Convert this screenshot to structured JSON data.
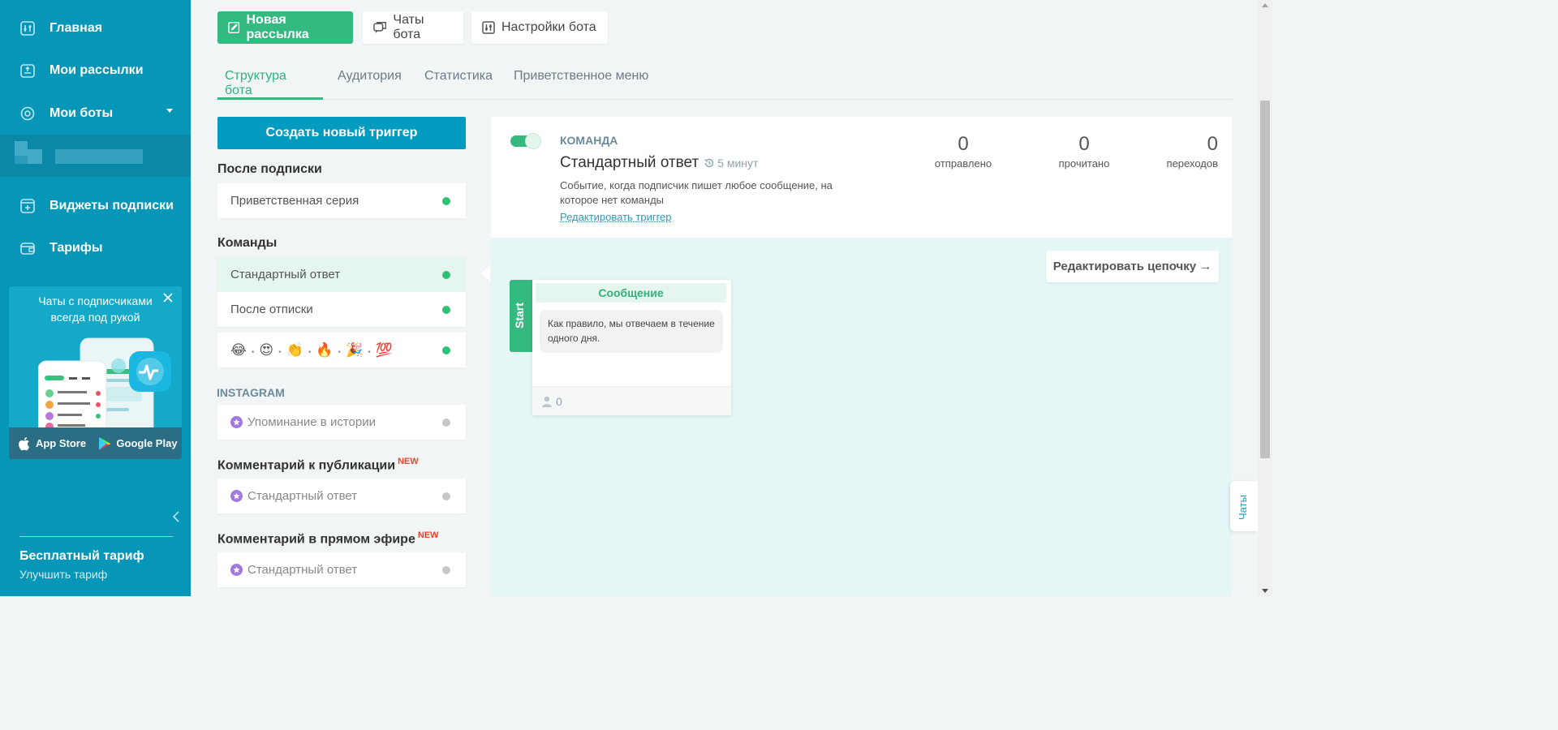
{
  "sidebar": {
    "nav": [
      {
        "label": "Главная",
        "icon": "home-icon"
      },
      {
        "label": "Мои рассылки",
        "icon": "mailing-icon"
      },
      {
        "label": "Мои боты",
        "icon": "bots-icon"
      },
      {
        "label": "Виджеты подписки",
        "icon": "widget-icon"
      },
      {
        "label": "Тарифы",
        "icon": "wallet-icon"
      }
    ],
    "promo": {
      "text": "Чаты с подписчиками всегда под рукой",
      "app_store": "App Store",
      "google_play": "Google Play"
    },
    "plan": {
      "title": "Бесплатный тариф",
      "link": "Улучшить тариф"
    }
  },
  "toolbar": {
    "new_mailing": "Новая рассылка",
    "bot_chats": "Чаты бота",
    "bot_settings": "Настройки бота"
  },
  "tabs": [
    "Структура бота",
    "Аудитория",
    "Статистика",
    "Приветственное меню"
  ],
  "triggers": {
    "create_button": "Создать новый триггер",
    "after_subscribe": {
      "title": "После подписки",
      "items": [
        "Приветственная серия"
      ]
    },
    "commands": {
      "title": "Команды",
      "items": [
        "Стандартный ответ",
        "После отписки"
      ],
      "emoji_item": [
        "😂",
        "😍",
        "👏",
        "🔥",
        "🎉",
        "💯"
      ]
    },
    "instagram": {
      "title": "INSTAGRAM",
      "items": [
        "Упоминание в истории"
      ]
    },
    "post_comment": {
      "title": "Комментарий к публикации",
      "badge": "NEW",
      "items": [
        "Стандартный ответ"
      ]
    },
    "live_comment": {
      "title": "Комментарий в прямом эфире",
      "badge": "NEW",
      "items": [
        "Стандартный ответ"
      ]
    }
  },
  "detail": {
    "kind": "КОМАНДА",
    "name": "Стандартный ответ",
    "delay": "5 минут",
    "description": "Событие, когда подписчик пишет любое сообщение, на которое нет команды",
    "edit_link": "Редактировать триггер",
    "stats": [
      {
        "value": "0",
        "label": "отправлено"
      },
      {
        "value": "0",
        "label": "прочитано"
      },
      {
        "value": "0",
        "label": "переходов"
      }
    ]
  },
  "chain": {
    "edit_button": "Редактировать цепочку →",
    "start_label": "Start",
    "node": {
      "title": "Сообщение",
      "text": "Как правило, мы отвечаем в течение одного дня.",
      "subscribers": "0"
    }
  },
  "chats_tab": "Чаты",
  "colors": {
    "sidebar": "#0596b8",
    "accent_green": "#34b980",
    "primary_blue": "#039cc0",
    "canvas": "#e5f6f6",
    "badge_new": "#e8462c"
  }
}
